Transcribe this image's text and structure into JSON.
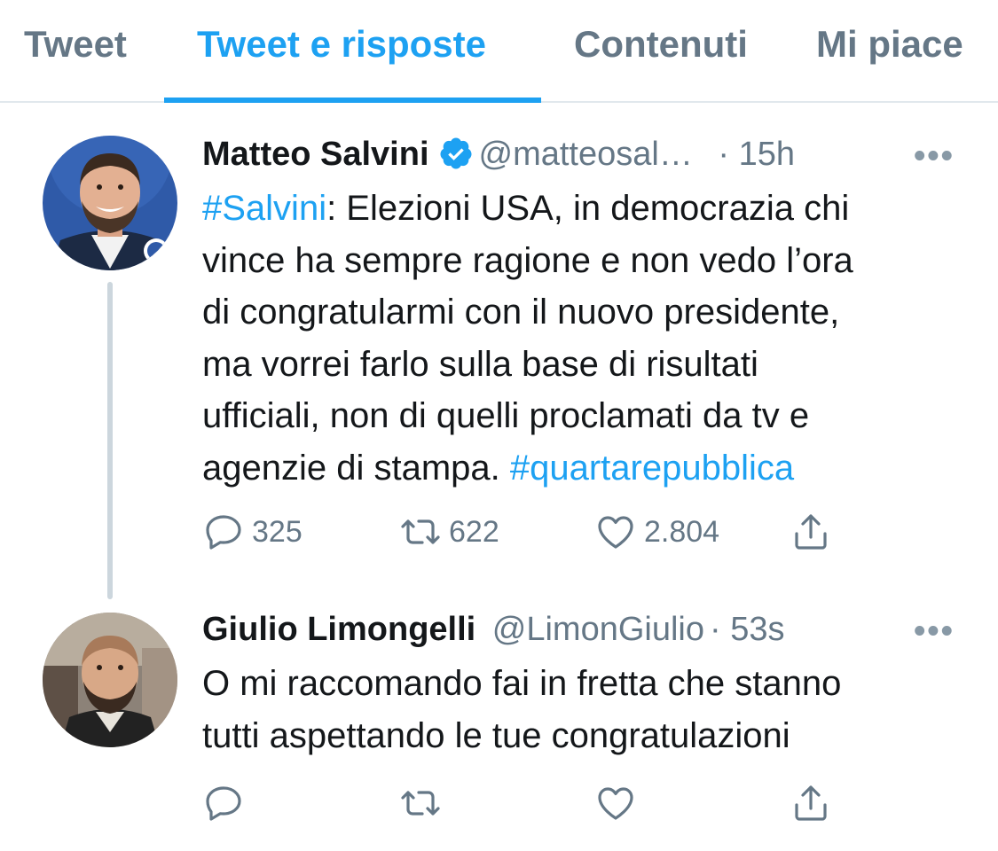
{
  "tabs": [
    {
      "label": "Tweet",
      "active": false
    },
    {
      "label": "Tweet e risposte",
      "active": true
    },
    {
      "label": "Contenuti",
      "active": false
    },
    {
      "label": "Mi piace",
      "active": false
    }
  ],
  "tweets": [
    {
      "name": "Matteo Salvini",
      "verified": true,
      "handle": "@matteosal…",
      "time": "· 15h",
      "more": "•••",
      "text_lines": [
        {
          "tag": "#Salvini",
          "rest": ": Elezioni USA, in democrazia chi"
        },
        {
          "rest": "vince ha sempre ragione e non vedo l’ora"
        },
        {
          "rest": "di congratularmi con il nuovo presidente,"
        },
        {
          "rest": "ma vorrei farlo sulla base di risultati"
        },
        {
          "rest": "ufficiali, non di quelli proclamati da tv e"
        },
        {
          "rest": "agenzie di stampa. ",
          "tag2": "#quartarepubblica"
        }
      ],
      "actions": {
        "reply": "325",
        "retweet": "622",
        "like": "2.804"
      }
    },
    {
      "name": "Giulio Limongelli",
      "verified": false,
      "handle": "@LimonGiulio",
      "time": "· 53s",
      "more": "•••",
      "text_lines": [
        {
          "rest": "O mi raccomando fai in fretta che stanno"
        },
        {
          "rest": "tutti aspettando le tue congratulazioni"
        }
      ],
      "actions": {
        "reply": "",
        "retweet": "",
        "like": ""
      }
    }
  ],
  "colors": {
    "accent": "#1da1f2",
    "muted": "#657786",
    "text": "#14171a",
    "divider": "#e1e8ed"
  },
  "icons": [
    "verified-badge-icon",
    "more-icon",
    "reply-icon",
    "retweet-icon",
    "like-icon",
    "share-icon"
  ]
}
